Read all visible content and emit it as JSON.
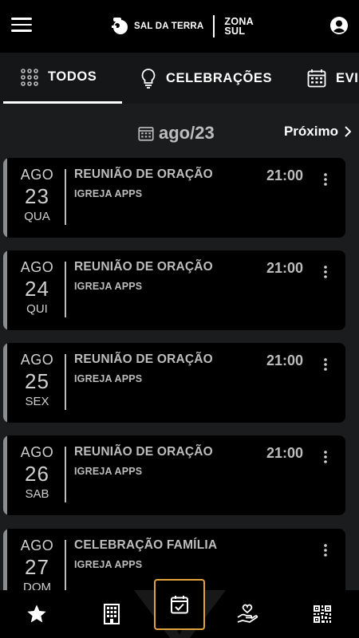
{
  "header": {
    "brand_name": "SAL DA TERRA",
    "brand_region_line1": "ZONA",
    "brand_region_line2": "SUL"
  },
  "tabs": [
    {
      "label": "TODOS",
      "icon": "dots-grid-icon",
      "active": true
    },
    {
      "label": "CELEBRAÇÕES",
      "icon": "lightbulb-icon",
      "active": false
    },
    {
      "label": "EVI",
      "icon": "calendar-icon",
      "active": false
    }
  ],
  "calendar_nav": {
    "month": "ago/23",
    "next_label": "Próximo"
  },
  "events": [
    {
      "month": "AGO",
      "day": "23",
      "weekday": "QUA",
      "title": "REUNIÃO DE ORAÇÃO",
      "organizer": "IGREJA APPS",
      "time": "21:00"
    },
    {
      "month": "AGO",
      "day": "24",
      "weekday": "QUI",
      "title": "REUNIÃO DE ORAÇÃO",
      "organizer": "IGREJA APPS",
      "time": "21:00"
    },
    {
      "month": "AGO",
      "day": "25",
      "weekday": "SEX",
      "title": "REUNIÃO DE ORAÇÃO",
      "organizer": "IGREJA APPS",
      "time": "21:00"
    },
    {
      "month": "AGO",
      "day": "26",
      "weekday": "SAB",
      "title": "REUNIÃO DE ORAÇÃO",
      "organizer": "IGREJA APPS",
      "time": "21:00"
    },
    {
      "month": "AGO",
      "day": "27",
      "weekday": "DOM",
      "title": "CELEBRAÇÃO FAMÍLIA",
      "organizer": "IGREJA APPS",
      "time": ""
    }
  ],
  "bottom_nav": [
    {
      "icon": "star-icon"
    },
    {
      "icon": "building-icon"
    },
    {
      "icon": "calendar-check-icon",
      "active": true
    },
    {
      "icon": "hand-heart-icon"
    },
    {
      "icon": "qr-code-icon"
    }
  ],
  "colors": {
    "background": "#1b1c1e",
    "card": "#000000",
    "accent_border": "#e3a33c",
    "muted_text": "#bdbdbd"
  }
}
